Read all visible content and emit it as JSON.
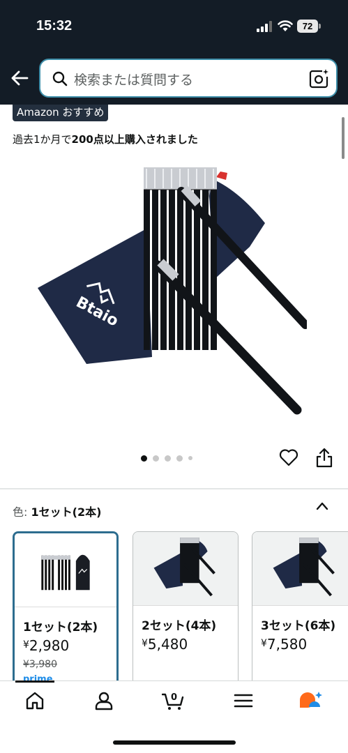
{
  "status_bar": {
    "time": "15:32",
    "battery": "72"
  },
  "search": {
    "placeholder": "検索または質問する"
  },
  "badge": "Amazon おすすめ",
  "purchase_note": {
    "prefix": "過去1か月で",
    "bold": "200点以上購入されました"
  },
  "gallery": {
    "image_count": 5,
    "active_index": 0
  },
  "variation": {
    "label": "色:",
    "selected": "1セット(2本)",
    "options": [
      {
        "name": "1セット(2本)",
        "currency": "¥",
        "price": "2,980",
        "old_price": "¥3,980",
        "prime": "prime",
        "selected": true
      },
      {
        "name": "2セット(4本)",
        "currency": "¥",
        "price": "5,480",
        "selected": false
      },
      {
        "name": "3セット(6本)",
        "currency": "¥",
        "price": "7,580",
        "selected": false
      }
    ]
  },
  "product": {
    "brand_logo_text": "Btaio"
  },
  "tab_bar": {
    "items": [
      {
        "name": "home-icon"
      },
      {
        "name": "account-icon"
      },
      {
        "name": "cart-icon",
        "count": "0"
      },
      {
        "name": "menu-icon"
      },
      {
        "name": "rufus-icon"
      }
    ]
  },
  "colors": {
    "header_bg": "#131c26",
    "search_border": "#3d8ea9",
    "selected_border": "#2d6d8f",
    "prime": "#1f8ce6",
    "rufus_orange": "#ff6a1a",
    "rufus_blue": "#1f8ce6"
  }
}
